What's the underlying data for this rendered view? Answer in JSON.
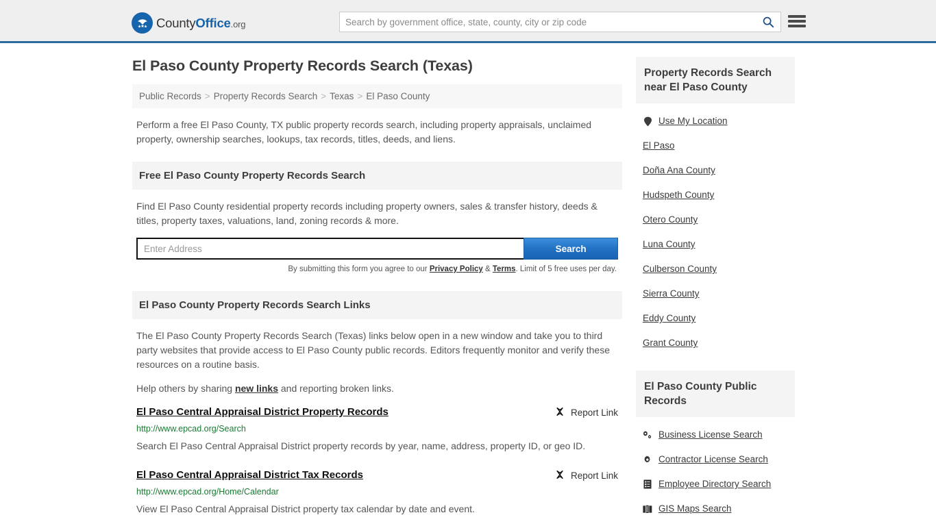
{
  "header": {
    "brand": {
      "part1": "County",
      "part2": "Office",
      "part3": ".org",
      "logo_alt": "county-office-seal"
    },
    "search": {
      "placeholder": "Search by government office, state, county, city or zip code",
      "value": ""
    }
  },
  "page": {
    "title": "El Paso County Property Records Search (Texas)",
    "breadcrumb": [
      "Public Records",
      "Property Records Search",
      "Texas",
      "El Paso County"
    ],
    "breadcrumb_separator": ">",
    "intro": "Perform a free El Paso County, TX public property records search, including property appraisals, unclaimed property, ownership searches, lookups, tax records, titles, deeds, and liens."
  },
  "free_search": {
    "heading": "Free El Paso County Property Records Search",
    "description": "Find El Paso County residential property records including property owners, sales & transfer history, deeds & titles, property taxes, valuations, land, zoning records & more.",
    "input_placeholder": "Enter Address",
    "input_value": "",
    "submit_label": "Search",
    "note_prefix": "By submitting this form you agree to our ",
    "note_privacy": "Privacy Policy",
    "note_amp": " & ",
    "note_terms": "Terms",
    "note_suffix": ". Limit of 5 free uses per day."
  },
  "links_section": {
    "heading": "El Paso County Property Records Search Links",
    "paragraph": "The El Paso County Property Records Search (Texas) links below open in a new window and take you to third party websites that provide access to El Paso County public records. Editors frequently monitor and verify these resources on a routine basis.",
    "help_prefix": "Help others by sharing ",
    "help_link": "new links",
    "help_suffix": " and reporting broken links.",
    "report_label": "Report Link",
    "results": [
      {
        "title": "El Paso Central Appraisal District Property Records",
        "url": "http://www.epcad.org/Search",
        "description": "Search El Paso Central Appraisal District property records by year, name, address, property ID, or geo ID."
      },
      {
        "title": "El Paso Central Appraisal District Tax Records",
        "url": "http://www.epcad.org/Home/Calendar",
        "description": "View El Paso Central Appraisal District property tax calendar by date and event."
      }
    ]
  },
  "sidebar": {
    "nearby": {
      "heading": "Property Records Search near El Paso County",
      "items": [
        {
          "label": "Use My Location",
          "icon": "map-pin-icon"
        },
        {
          "label": "El Paso",
          "icon": ""
        },
        {
          "label": "Doña Ana County",
          "icon": ""
        },
        {
          "label": "Hudspeth County",
          "icon": ""
        },
        {
          "label": "Otero County",
          "icon": ""
        },
        {
          "label": "Luna County",
          "icon": ""
        },
        {
          "label": "Culberson County",
          "icon": ""
        },
        {
          "label": "Sierra County",
          "icon": ""
        },
        {
          "label": "Eddy County",
          "icon": ""
        },
        {
          "label": "Grant County",
          "icon": ""
        }
      ]
    },
    "public_records": {
      "heading": "El Paso County Public Records",
      "items": [
        {
          "label": "Business License Search",
          "icon": "gears-icon"
        },
        {
          "label": "Contractor License Search",
          "icon": "gear-icon"
        },
        {
          "label": "Employee Directory Search",
          "icon": "list-document-icon"
        },
        {
          "label": "GIS Maps Search",
          "icon": "map-book-icon"
        }
      ]
    }
  },
  "colors": {
    "brand_blue": "#1664ab",
    "header_bg": "#efefef",
    "header_rule": "#2c6aa0",
    "panel_bg": "#f4f4f4",
    "url_green": "#1a7a33",
    "button_blue": "#2272c4"
  }
}
